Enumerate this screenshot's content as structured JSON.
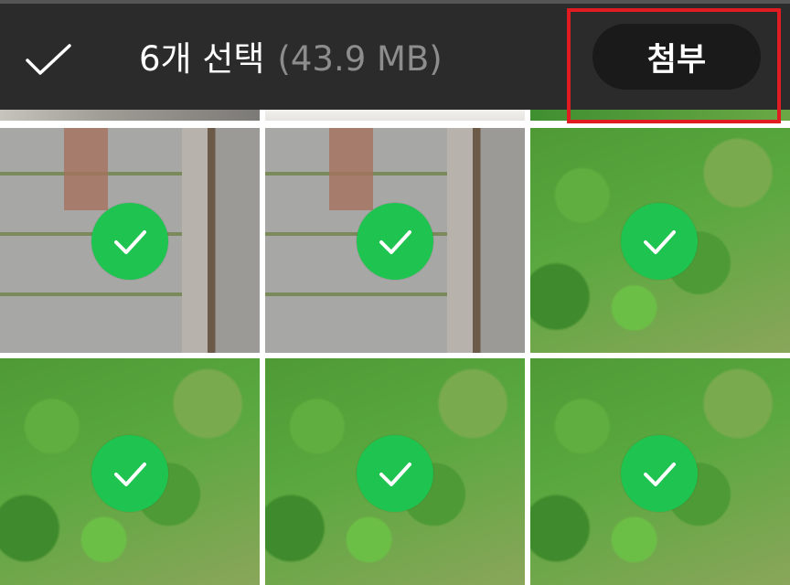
{
  "header": {
    "selection_label": "6개 선택",
    "selection_size": "(43.9 MB)",
    "attach_label": "첨부"
  },
  "icons": {
    "done": "checkmark-icon",
    "selected": "selected-check-icon"
  },
  "colors": {
    "header_bg": "#2b2b2b",
    "attach_button_bg": "#1a1a1a",
    "selected_badge": "#1fc34f",
    "highlight_box": "#e01c22",
    "size_text": "#8d8d8d"
  },
  "gallery": {
    "selected_count": 6
  }
}
